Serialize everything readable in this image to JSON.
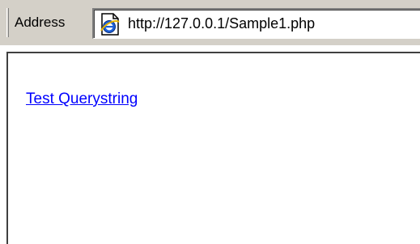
{
  "address_bar": {
    "label": "Address",
    "url": "http://127.0.0.1/Sample1.php",
    "page_icon": "ie-page-icon"
  },
  "content": {
    "link_text": "Test Querystring"
  },
  "colors": {
    "toolbar": "#d4d0c8",
    "link": "#0000ff",
    "background": "#ffffff"
  }
}
